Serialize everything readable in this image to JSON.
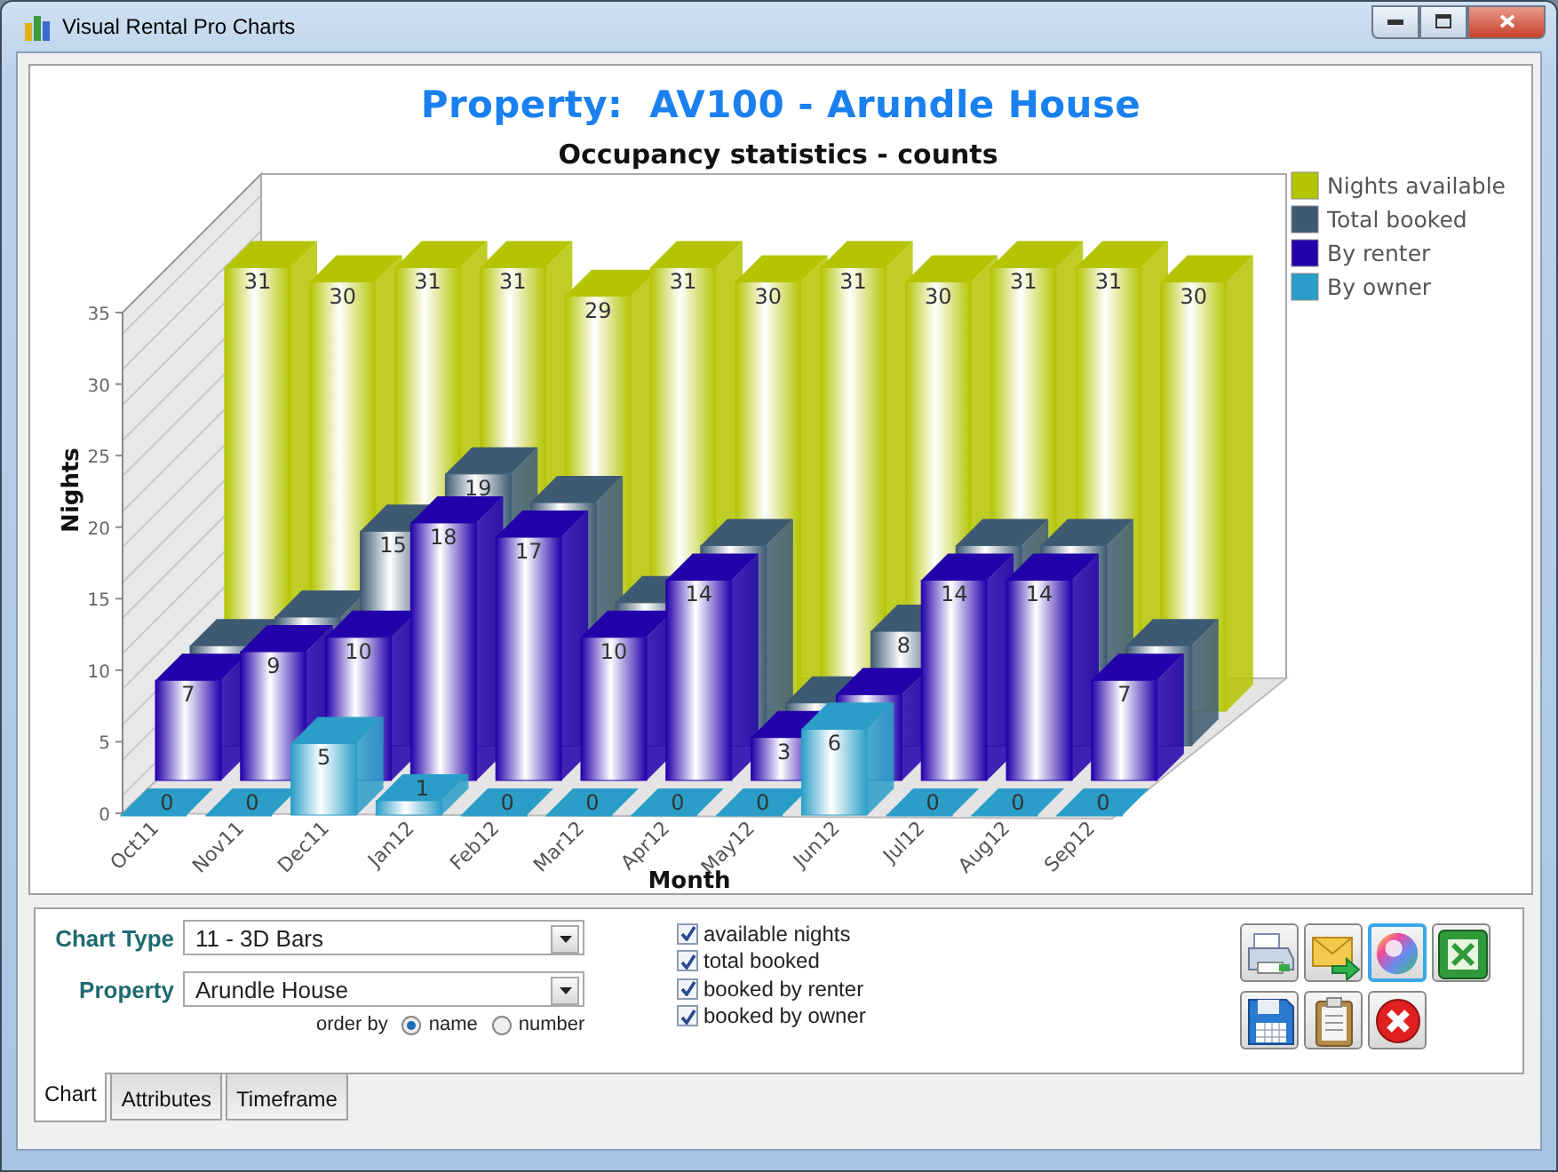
{
  "window": {
    "title": "Visual Rental Pro Charts"
  },
  "chart": {
    "heading": "Property:  AV100 - Arundle House",
    "title": "Occupancy statistics - counts",
    "ylabel": "Nights",
    "xlabel": "Month",
    "y_ticks": [
      "35",
      "30",
      "25",
      "20",
      "15",
      "10",
      "5",
      "0"
    ],
    "series": [
      {
        "name": "Nights available",
        "color": "#b4c400"
      },
      {
        "name": "Total booked",
        "color": "#3e5a72"
      },
      {
        "name": "By renter",
        "color": "#2200aa"
      },
      {
        "name": "By owner",
        "color": "#2a9ec8"
      }
    ],
    "months": [
      {
        "label": "Oct11",
        "available": "31",
        "by_renter": "7",
        "by_owner": "0"
      },
      {
        "label": "Nov11",
        "available": "30",
        "by_renter": "9",
        "by_owner": "0"
      },
      {
        "label": "Dec11",
        "available": "31",
        "total_booked": "15",
        "by_renter": "10",
        "by_owner": "5"
      },
      {
        "label": "Jan12",
        "available": "31",
        "total_booked": "19",
        "by_renter": "18",
        "by_owner": "1"
      },
      {
        "label": "Feb12",
        "available": "29",
        "by_renter": "17",
        "by_owner": "0"
      },
      {
        "label": "Mar12",
        "available": "31",
        "by_renter": "10",
        "by_owner": "0"
      },
      {
        "label": "Apr12",
        "available": "30",
        "by_renter": "14",
        "by_owner": "0"
      },
      {
        "label": "May12",
        "available": "31",
        "by_renter": "3",
        "by_owner": "0"
      },
      {
        "label": "Jun12",
        "available": "30",
        "total_booked": "8",
        "by_owner": "6"
      },
      {
        "label": "Jul12",
        "available": "31",
        "by_renter": "14",
        "by_owner": "0"
      },
      {
        "label": "Aug12",
        "available": "31",
        "by_renter": "14",
        "by_owner": "0"
      },
      {
        "label": "Sep12",
        "available": "30",
        "by_renter": "7",
        "by_owner": "0"
      }
    ]
  },
  "controls": {
    "chart_type": {
      "label": "Chart Type",
      "value": "11 - 3D Bars"
    },
    "property": {
      "label": "Property",
      "value": "Arundle House"
    },
    "order_by": {
      "label": "order by",
      "options": [
        {
          "label": "name",
          "selected": true
        },
        {
          "label": "number",
          "selected": false
        }
      ]
    },
    "series_toggles": [
      {
        "label": "available nights",
        "checked": true
      },
      {
        "label": "total booked",
        "checked": true
      },
      {
        "label": "booked by renter",
        "checked": true
      },
      {
        "label": "booked by owner",
        "checked": true
      }
    ],
    "actions": [
      {
        "kind": "print"
      },
      {
        "kind": "email"
      },
      {
        "kind": "colors"
      },
      {
        "kind": "excel"
      },
      {
        "kind": "save"
      },
      {
        "kind": "clipboard"
      },
      {
        "kind": "close"
      }
    ]
  },
  "tabs": [
    {
      "label": "Chart",
      "selected": true
    },
    {
      "label": "Attributes",
      "selected": false
    },
    {
      "label": "Timeframe",
      "selected": false
    }
  ]
}
